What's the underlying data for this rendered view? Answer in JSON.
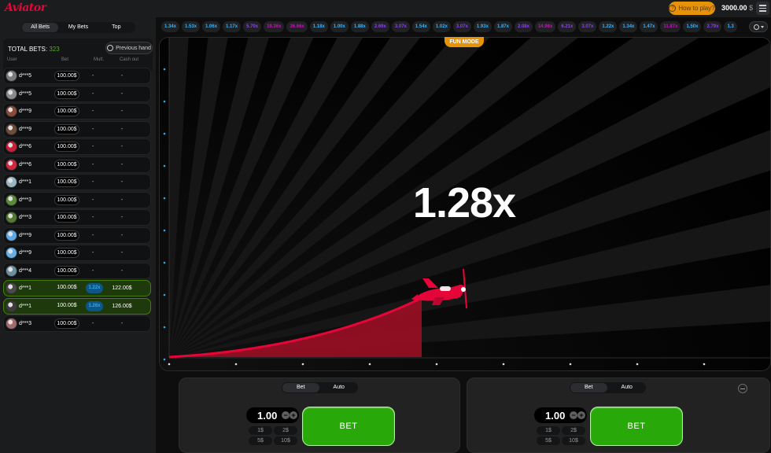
{
  "app": {
    "logo": "Aviator"
  },
  "header": {
    "how_to_play": "How to play?",
    "balance_amount": "3000.00",
    "balance_currency": "$"
  },
  "bets_panel": {
    "tabs": [
      "All Bets",
      "My Bets",
      "Top"
    ],
    "active_tab": "All Bets",
    "total_label": "TOTAL BETS:",
    "total_count": "323",
    "previous_hand": "Previous hand",
    "columns": {
      "user": "User",
      "bet": "Bet",
      "mult": "Mult.",
      "cashout": "Cash out"
    },
    "rows": [
      {
        "user": "d***5",
        "bet": "100.00$",
        "mult": "-",
        "cashout": "-",
        "win": false,
        "avatar_color": "#7a7a7a"
      },
      {
        "user": "d***5",
        "bet": "100.00$",
        "mult": "-",
        "cashout": "-",
        "win": false,
        "avatar_color": "#8a8a8a"
      },
      {
        "user": "d***9",
        "bet": "100.00$",
        "mult": "-",
        "cashout": "-",
        "win": false,
        "avatar_color": "#8a4b3a"
      },
      {
        "user": "d***9",
        "bet": "100.00$",
        "mult": "-",
        "cashout": "-",
        "win": false,
        "avatar_color": "#6e4c3a"
      },
      {
        "user": "d***6",
        "bet": "100.00$",
        "mult": "-",
        "cashout": "-",
        "win": false,
        "avatar_color": "#c8203a"
      },
      {
        "user": "d***6",
        "bet": "100.00$",
        "mult": "-",
        "cashout": "-",
        "win": false,
        "avatar_color": "#d0283e"
      },
      {
        "user": "d***1",
        "bet": "100.00$",
        "mult": "-",
        "cashout": "-",
        "win": false,
        "avatar_color": "#9ab6c2"
      },
      {
        "user": "d***3",
        "bet": "100.00$",
        "mult": "-",
        "cashout": "-",
        "win": false,
        "avatar_color": "#5d8a3a"
      },
      {
        "user": "d***3",
        "bet": "100.00$",
        "mult": "-",
        "cashout": "-",
        "win": false,
        "avatar_color": "#527a30"
      },
      {
        "user": "d***9",
        "bet": "100.00$",
        "mult": "-",
        "cashout": "-",
        "win": false,
        "avatar_color": "#5fa8e6"
      },
      {
        "user": "d***9",
        "bet": "100.00$",
        "mult": "-",
        "cashout": "-",
        "win": false,
        "avatar_color": "#66aee8"
      },
      {
        "user": "d***4",
        "bet": "100.00$",
        "mult": "-",
        "cashout": "-",
        "win": false,
        "avatar_color": "#6c8fa0"
      },
      {
        "user": "d***1",
        "bet": "100.00$",
        "mult": "1.22x",
        "cashout": "122.00$",
        "win": true,
        "avatar_color": "#4a4a4a"
      },
      {
        "user": "d***1",
        "bet": "100.00$",
        "mult": "1.26x",
        "cashout": "126.00$",
        "win": true,
        "avatar_color": "#3c3c3c"
      },
      {
        "user": "d***3",
        "bet": "100.00$",
        "mult": "-",
        "cashout": "-",
        "win": false,
        "avatar_color": "#a26a6a"
      }
    ]
  },
  "history": [
    {
      "v": "1.34x",
      "c": "blue"
    },
    {
      "v": "1.53x",
      "c": "blue"
    },
    {
      "v": "1.06x",
      "c": "blue"
    },
    {
      "v": "1.17x",
      "c": "blue"
    },
    {
      "v": "5.70x",
      "c": "purple"
    },
    {
      "v": "19.36x",
      "c": "pink"
    },
    {
      "v": "26.66x",
      "c": "pink"
    },
    {
      "v": "1.18x",
      "c": "blue"
    },
    {
      "v": "1.00x",
      "c": "blue"
    },
    {
      "v": "1.88x",
      "c": "blue"
    },
    {
      "v": "2.69x",
      "c": "purple"
    },
    {
      "v": "3.07x",
      "c": "purple"
    },
    {
      "v": "1.54x",
      "c": "blue"
    },
    {
      "v": "1.02x",
      "c": "blue"
    },
    {
      "v": "3.07x",
      "c": "purple"
    },
    {
      "v": "1.93x",
      "c": "blue"
    },
    {
      "v": "1.87x",
      "c": "blue"
    },
    {
      "v": "2.08x",
      "c": "purple"
    },
    {
      "v": "14.98x",
      "c": "pink"
    },
    {
      "v": "6.21x",
      "c": "purple"
    },
    {
      "v": "3.07x",
      "c": "purple"
    },
    {
      "v": "1.22x",
      "c": "blue"
    },
    {
      "v": "1.34x",
      "c": "blue"
    },
    {
      "v": "1.47x",
      "c": "blue"
    },
    {
      "v": "11.87x",
      "c": "pink"
    },
    {
      "v": "1.50x",
      "c": "blue"
    },
    {
      "v": "2.79x",
      "c": "purple"
    },
    {
      "v": "1.3",
      "c": "blue"
    }
  ],
  "game": {
    "fun_mode": "FUN MODE",
    "multiplier": "1.28x",
    "accent": "#e50539"
  },
  "bet_panels": [
    {
      "tabs": [
        "Bet",
        "Auto"
      ],
      "amount": "1.00",
      "quick": [
        "1$",
        "2$",
        "5$",
        "10$"
      ],
      "bet_label": "BET"
    },
    {
      "tabs": [
        "Bet",
        "Auto"
      ],
      "amount": "1.00",
      "quick": [
        "1$",
        "2$",
        "5$",
        "10$"
      ],
      "bet_label": "BET"
    }
  ]
}
